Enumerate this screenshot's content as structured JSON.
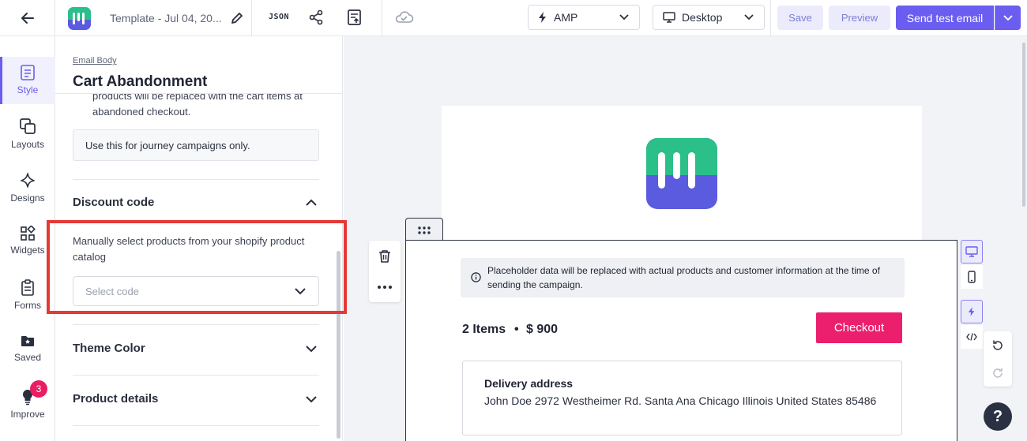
{
  "topbar": {
    "template_name": "Template - Jul 04, 20...",
    "json_label": "JSON",
    "amp_label": "AMP",
    "device_label": "Desktop",
    "save_label": "Save",
    "preview_label": "Preview",
    "send_label": "Send test email"
  },
  "rail": {
    "items": [
      {
        "label": "Style",
        "icon": "style-icon",
        "active": true
      },
      {
        "label": "Layouts",
        "icon": "layouts-icon"
      },
      {
        "label": "Designs",
        "icon": "sparkle-icon"
      },
      {
        "label": "Widgets",
        "icon": "widgets-icon"
      },
      {
        "label": "Forms",
        "icon": "forms-icon"
      },
      {
        "label": "Saved",
        "icon": "saved-folder-icon"
      },
      {
        "label": "Improve",
        "icon": "lightbulb-icon",
        "badge": "3"
      }
    ]
  },
  "panel": {
    "breadcrumb": "Email Body",
    "title": "Cart Abandonment",
    "clipped_text": "products will be replaced with the cart items at abandoned checkout.",
    "note": "Use this for journey campaigns only.",
    "discount": {
      "heading": "Discount code",
      "description": "Manually select products from your shopify product catalog",
      "select_placeholder": "Select code"
    },
    "theme_color_heading": "Theme Color",
    "product_details_heading": "Product details"
  },
  "email": {
    "info_text": "Placeholder data will be replaced with actual products and customer information at the time of sending the campaign.",
    "items_count": "2 Items",
    "separator": "•",
    "price": "$ 900",
    "checkout_label": "Checkout",
    "address_title": "Delivery address",
    "address_text": "John Doe 2972 Westheimer Rd. Santa Ana Chicago Illinois United States 85486"
  },
  "help_label": "?",
  "colors": {
    "accent": "#6a5df0",
    "checkout": "#ec1f6e",
    "highlight": "#e53935",
    "logo_green": "#2bbf8a",
    "logo_blue": "#5b5be0"
  }
}
